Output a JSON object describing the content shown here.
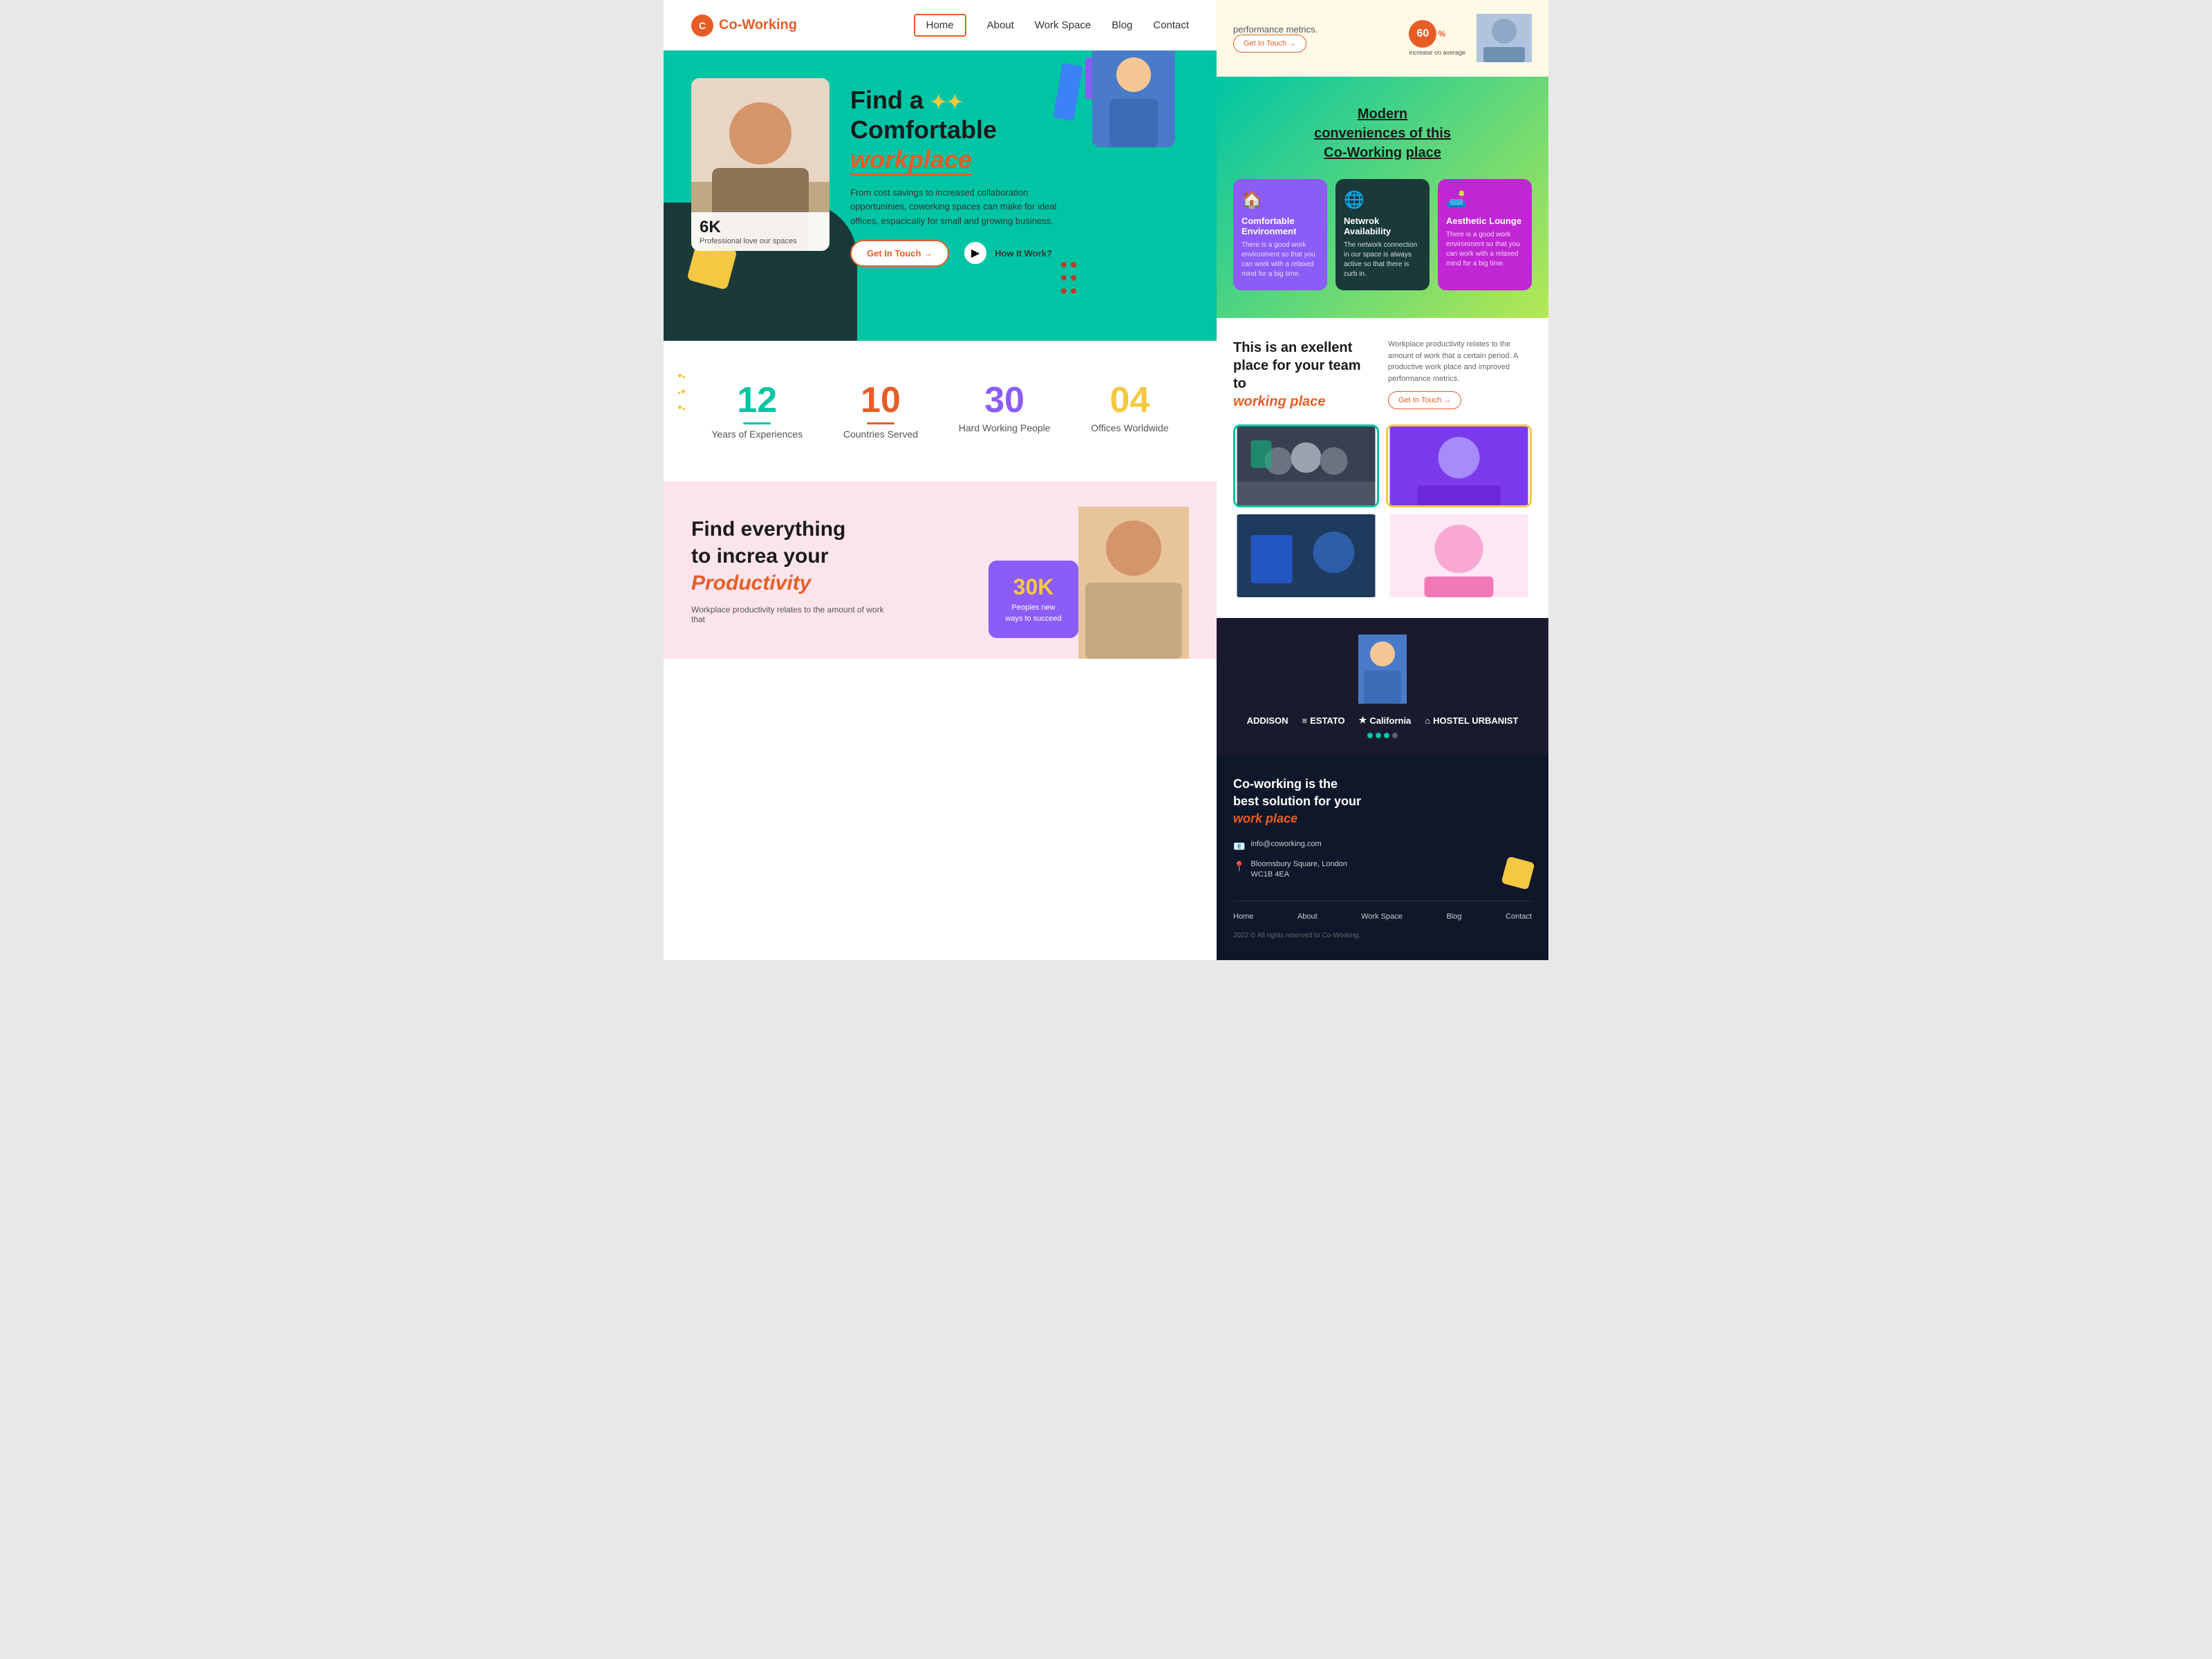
{
  "nav": {
    "logo_text_co": "Co-",
    "logo_text_working": "Working",
    "links": [
      {
        "label": "Home",
        "active": true
      },
      {
        "label": "About",
        "active": false
      },
      {
        "label": "Work Space",
        "active": false
      },
      {
        "label": "Blog",
        "active": false
      },
      {
        "label": "Contact",
        "active": false
      }
    ]
  },
  "hero": {
    "stat_number": "6K",
    "stat_label": "Professional love our spaces",
    "title_line1": "Find a",
    "title_line2": "Comfortable",
    "title_highlight": "workplace",
    "description": "From cost savings  to increased collaboration opportuninies, coworking spaces can make for ideal  offices, espacically for small and growing business.",
    "cta_primary": "Get In Touch →",
    "cta_secondary": "How It Work?"
  },
  "stats": [
    {
      "number": "12",
      "label": "Years of Experiences",
      "color": "teal"
    },
    {
      "number": "10",
      "label": "Countries Served",
      "color": "orange"
    },
    {
      "number": "30",
      "label": "Hard Working People",
      "color": "purple"
    },
    {
      "number": "04",
      "label": "Offices Worldwide",
      "color": "yellow"
    }
  ],
  "productivity": {
    "title_line1": "Find everything",
    "title_line2": "to increa your",
    "title_highlight": "Productivity",
    "description": "Workplace productivity relates to the amount of work that",
    "card_number": "30K",
    "card_label": "Peoples new ways to succeed"
  },
  "right_top_bar": {
    "text": "performance metrics.",
    "badge": "60",
    "badge_suffix": "%",
    "stat_label": "increase on average",
    "btn_label": "Get In Touch →"
  },
  "modern": {
    "title_line1": "Modern",
    "title_line2": "conveniences of this",
    "title_brand": "Co-Working",
    "title_line3": "place",
    "cards": [
      {
        "icon": "🏠",
        "title": "Comfortable Environment",
        "desc": "There is a good work environment so that you can work with a relaxed mind for a big time.",
        "color": "purple"
      },
      {
        "icon": "🌐",
        "title": "Netwrok Availability",
        "desc": "The network connection in our space is always active so that there is curb in.",
        "color": "dark"
      },
      {
        "icon": "🛋️",
        "title": "Aesthetic Lounge",
        "desc": "There is a good work environment so that you can work with a relaxed mind for a big time.",
        "color": "magenta"
      }
    ]
  },
  "excellent": {
    "title_line1": "This is an exellent",
    "title_line2": "place for your team to",
    "title_highlight": "working place",
    "description": "Workplace productivity relates to the amount of work that a certain period. A productive work place and improved performance metrics.",
    "btn_label": "Get In Touch →"
  },
  "brands": [
    {
      "name": "ADDISON",
      "prefix": ""
    },
    {
      "name": "ESTATO",
      "prefix": "≡ "
    },
    {
      "name": "California",
      "prefix": "★ "
    },
    {
      "name": "HOSTEL URBANIST",
      "prefix": "⌂ "
    }
  ],
  "footer": {
    "title_line1": "Co-working is the",
    "title_line2": "best solution for your",
    "title_highlight": "work place",
    "contact_email": "info@coworking.com",
    "contact_address_line1": "Bloomsbury Square, London",
    "contact_address_line2": "WC1B 4EA",
    "nav_links": [
      "Home",
      "About",
      "Work Space",
      "Blog",
      "Contact"
    ],
    "copyright": "2022 © All rights reserved to Co-Working."
  }
}
